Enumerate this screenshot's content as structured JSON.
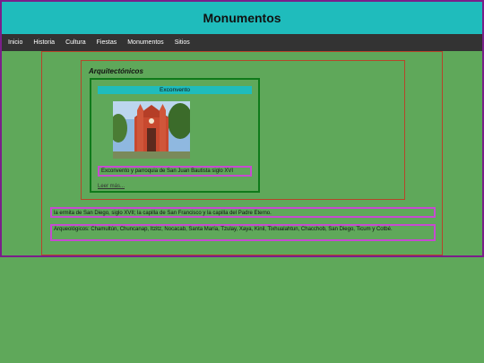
{
  "header": {
    "title": "Monumentos"
  },
  "nav": {
    "items": [
      "Inicio",
      "Historia",
      "Cultura",
      "Fiestas",
      "Monumentos",
      "Sitios"
    ]
  },
  "section": {
    "heading": "Arquitectónicos",
    "card": {
      "title": "Exconvento",
      "caption": "Exconvento y parroquia de San Juan Bautista siglo XVI",
      "read_more": "Leer más..."
    }
  },
  "paragraphs": {
    "p1": "la ermita de San Diego, siglo XVII; la capilla de San Francisco y la capilla del Padre Eterno.",
    "p2": "Arqueológicos: Chamultún, Chuncanap, Itzitz, Nocacab, Santa María, Tzulay, Xaya, Kinil, Tixhualahtun, Chacchob, San Diego, Ticum y Cotbé."
  },
  "colors": {
    "header_bg": "#1fbcbc",
    "nav_bg": "#333333",
    "page_bg": "#5fa85a",
    "card_border": "#0f7a1a",
    "highlight_border": "#c64bd0"
  }
}
